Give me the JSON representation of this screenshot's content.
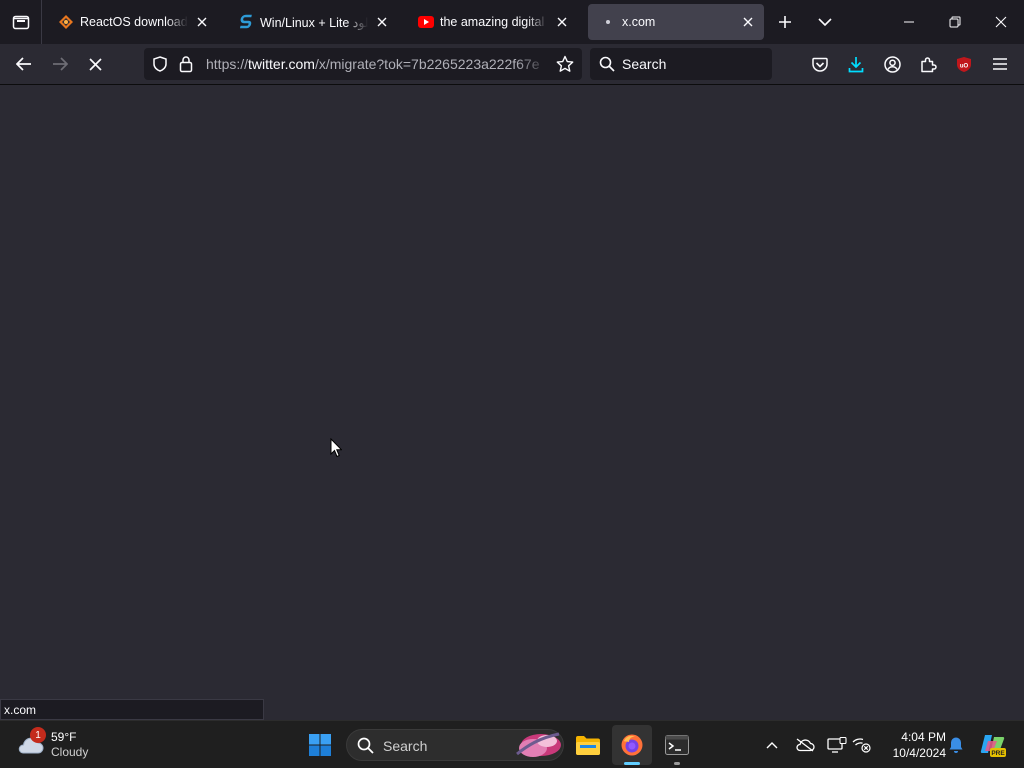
{
  "browser": {
    "tabs": [
      {
        "title": "ReactOS download | So",
        "favicon": "reactos-icon"
      },
      {
        "title": "Win/Linux + Lite دانلود",
        "favicon": "site-s-icon"
      },
      {
        "title": "the amazing digital circ",
        "favicon": "youtube-icon"
      },
      {
        "title": "x.com",
        "favicon": "loading-dot-icon",
        "active": true
      }
    ],
    "url": {
      "prefix": "https://",
      "host": "twitter.com",
      "path": "/x/migrate?tok=7b2265223a222f67e"
    },
    "search_placeholder": "Search",
    "status_text": "x.com",
    "colors": {
      "ublock": "#c0171c",
      "download": "#54ffbd",
      "accent": "#00ddff"
    }
  },
  "taskbar": {
    "weather": {
      "badge": "1",
      "temp": "59°F",
      "condition": "Cloudy"
    },
    "search_label": "Search",
    "clock": {
      "time": "4:04 PM",
      "date": "10/4/2024"
    },
    "copilot_badge": "PRE"
  }
}
